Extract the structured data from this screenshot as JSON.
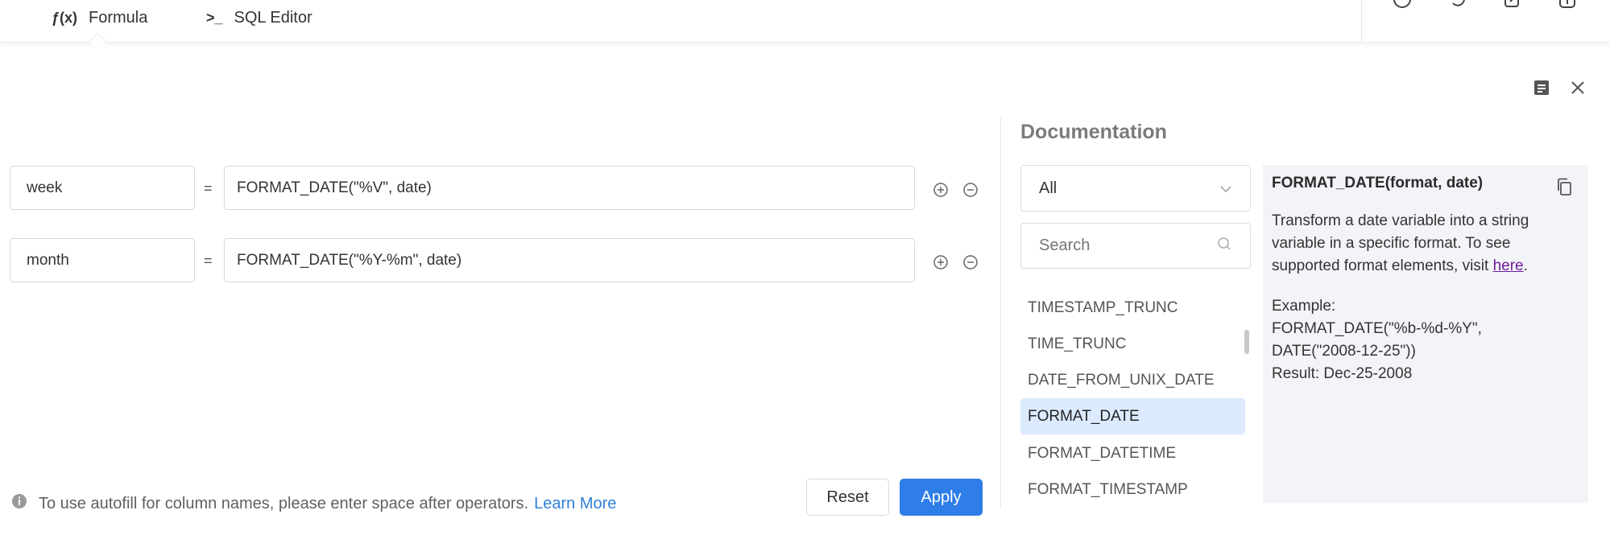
{
  "tabs": [
    {
      "icon_label": "ƒ(x)",
      "label": "Formula"
    },
    {
      "icon_label": ">_",
      "label": "SQL Editor"
    }
  ],
  "formulas": [
    {
      "name": "week",
      "eq": "=",
      "expression": "FORMAT_DATE(\"%V\", date)"
    },
    {
      "name": "month",
      "eq": "=",
      "expression": "FORMAT_DATE(\"%Y-%m\", date)"
    }
  ],
  "footer": {
    "hint": "To use autofill for column names, please enter space after operators.",
    "learn_more": "Learn More",
    "reset": "Reset",
    "apply": "Apply"
  },
  "documentation": {
    "title": "Documentation",
    "category": "All",
    "search_placeholder": "Search",
    "functions": [
      "TIMESTAMP_TRUNC",
      "TIME_TRUNC",
      "DATE_FROM_UNIX_DATE",
      "FORMAT_DATE",
      "FORMAT_DATETIME",
      "FORMAT_TIMESTAMP"
    ],
    "selected_function": "FORMAT_DATE",
    "detail": {
      "signature": "FORMAT_DATE(format, date)",
      "description_before_link": "Transform a date variable into a string variable in a specific format. To see supported format elements, visit",
      "link_text": "here",
      "description_after_link": ".",
      "example_label": "Example:",
      "example_code_1": "FORMAT_DATE(\"%b-%d-%Y\",",
      "example_code_2": "DATE(\"2008-12-25\"))",
      "result": "Result: Dec-25-2008"
    }
  },
  "icons": {
    "top": [
      "refresh-circle-icon",
      "sync-icon",
      "edit-share-icon",
      "info-bubble-icon"
    ],
    "panel": [
      "notes-icon",
      "close-icon"
    ]
  },
  "colors": {
    "accent": "#2f7de8",
    "link": "#2f7fd8",
    "selected_bg": "#dceafe",
    "card_bg": "#f2f4f8"
  }
}
